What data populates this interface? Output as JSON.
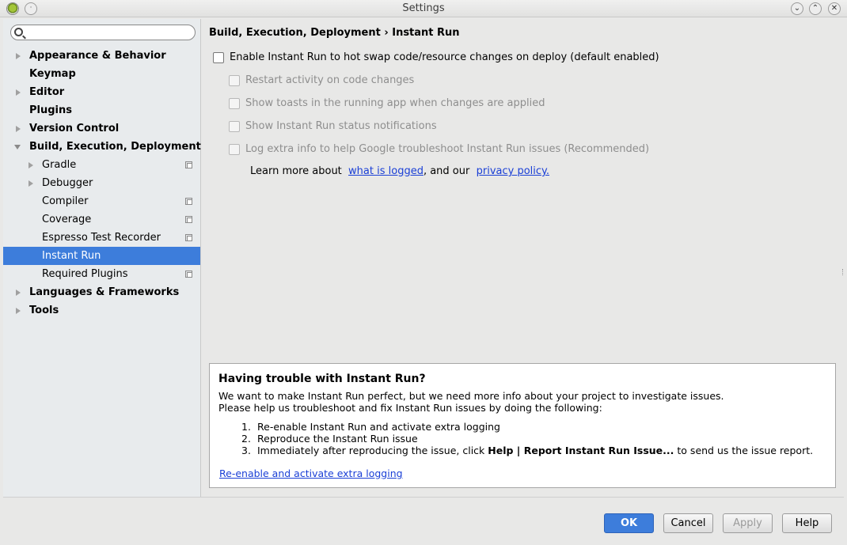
{
  "window": {
    "title": "Settings",
    "minimize_glyph": "⌄",
    "maximize_glyph": "⌃",
    "close_glyph": "✕"
  },
  "search": {
    "value": "",
    "placeholder": ""
  },
  "sidebar": {
    "items": [
      {
        "label": "Appearance & Behavior",
        "level": 0,
        "arrow": "right",
        "bold": true
      },
      {
        "label": "Keymap",
        "level": 0,
        "arrow": "none",
        "bold": true
      },
      {
        "label": "Editor",
        "level": 0,
        "arrow": "right",
        "bold": true
      },
      {
        "label": "Plugins",
        "level": 0,
        "arrow": "none",
        "bold": true
      },
      {
        "label": "Version Control",
        "level": 0,
        "arrow": "right",
        "bold": true
      },
      {
        "label": "Build, Execution, Deployment",
        "level": 0,
        "arrow": "down",
        "bold": true
      },
      {
        "label": "Gradle",
        "level": 1,
        "arrow": "right",
        "project_icon": true
      },
      {
        "label": "Debugger",
        "level": 1,
        "arrow": "right"
      },
      {
        "label": "Compiler",
        "level": 1,
        "arrow": "none",
        "project_icon": true
      },
      {
        "label": "Coverage",
        "level": 1,
        "arrow": "none",
        "project_icon": true
      },
      {
        "label": "Espresso Test Recorder",
        "level": 1,
        "arrow": "none",
        "project_icon": true
      },
      {
        "label": "Instant Run",
        "level": 1,
        "arrow": "none",
        "selected": true
      },
      {
        "label": "Required Plugins",
        "level": 1,
        "arrow": "none",
        "project_icon": true
      },
      {
        "label": "Languages & Frameworks",
        "level": 0,
        "arrow": "right",
        "bold": true
      },
      {
        "label": "Tools",
        "level": 0,
        "arrow": "right",
        "bold": true
      }
    ]
  },
  "main": {
    "breadcrumb": "Build, Execution, Deployment › Instant Run",
    "options": [
      {
        "label": "Enable Instant Run to hot swap code/resource changes on deploy (default enabled)",
        "checked": false,
        "enabled": true
      },
      {
        "label": "Restart activity on code changes",
        "checked": false,
        "enabled": false
      },
      {
        "label": "Show toasts in the running app when changes are applied",
        "checked": false,
        "enabled": false
      },
      {
        "label": "Show Instant Run status notifications",
        "checked": false,
        "enabled": false
      },
      {
        "label": "Log extra info to help Google troubleshoot Instant Run issues (Recommended)",
        "checked": false,
        "enabled": false
      }
    ],
    "learn_more": {
      "prefix": "Learn more about",
      "link1": "what is logged",
      "middle": ", and our",
      "link2": "privacy policy."
    },
    "trouble": {
      "heading": "Having trouble with Instant Run?",
      "line1": "We want to make Instant Run perfect, but we need more info about your project to investigate issues.",
      "line2": "Please help us troubleshoot and fix Instant Run issues by doing the following:",
      "steps": [
        {
          "num": "1.",
          "text": "Re-enable Instant Run and activate extra logging"
        },
        {
          "num": "2.",
          "text": "Reproduce the Instant Run issue"
        },
        {
          "num": "3.",
          "pre": "Immediately after reproducing the issue, click",
          "bold": "Help | Report Instant Run Issue...",
          "post": "to send us the issue report."
        }
      ],
      "link": "Re-enable and activate extra logging"
    }
  },
  "buttons": {
    "ok": "OK",
    "cancel": "Cancel",
    "apply": "Apply",
    "help": "Help"
  },
  "colors": {
    "selection": "#3d7ddb",
    "link": "#1a3fd6",
    "sidebar_bg": "#e8ebed"
  }
}
